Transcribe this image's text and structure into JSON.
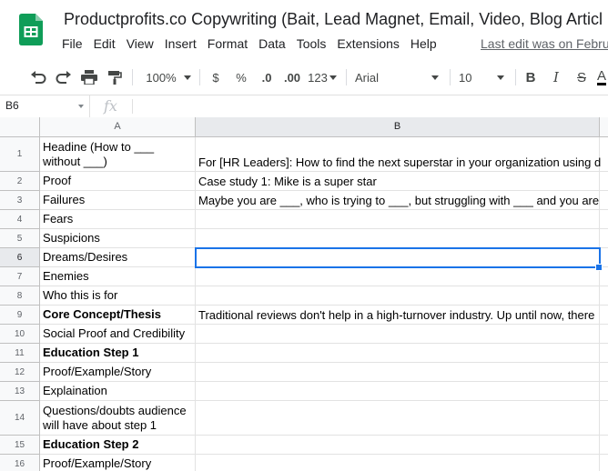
{
  "doc": {
    "title": "Productprofits.co Copywriting (Bait, Lead Magnet, Email, Video, Blog Articl",
    "last_edit": "Last edit was on Febru"
  },
  "menu": [
    "File",
    "Edit",
    "View",
    "Insert",
    "Format",
    "Data",
    "Tools",
    "Extensions",
    "Help"
  ],
  "toolbar": {
    "zoom": "100%",
    "currency": "$",
    "percent": "%",
    "decrease_decimal": ".0",
    "increase_decimal": ".00",
    "more_formats": "123",
    "font": "Arial",
    "font_size": "10",
    "bold": "B",
    "italic": "I",
    "strike": "S",
    "text_color": "A"
  },
  "formula_bar": {
    "cell_ref": "B6",
    "fx": "fx"
  },
  "columns": [
    "A",
    "B"
  ],
  "rows": [
    {
      "num": "1",
      "a": "Headine (How to ___ without ___)",
      "b": "For [HR Leaders]: How to find the next superstar in your organization using d"
    },
    {
      "num": "2",
      "a": "Proof",
      "b": "Case study 1: Mike is a super star"
    },
    {
      "num": "3",
      "a": "Failures",
      "b": "Maybe you are ___, who is trying to ___, but struggling with ___ and you are"
    },
    {
      "num": "4",
      "a": "Fears",
      "b": ""
    },
    {
      "num": "5",
      "a": "Suspicions",
      "b": ""
    },
    {
      "num": "6",
      "a": "Dreams/Desires",
      "b": ""
    },
    {
      "num": "7",
      "a": "Enemies",
      "b": ""
    },
    {
      "num": "8",
      "a": "Who this is for",
      "b": ""
    },
    {
      "num": "9",
      "a": "Core Concept/Thesis",
      "b": "Traditional reviews don't help in a high-turnover industry. Up until now, there"
    },
    {
      "num": "10",
      "a": "Social Proof and Credibility",
      "b": ""
    },
    {
      "num": "11",
      "a": "Education Step 1",
      "b": ""
    },
    {
      "num": "12",
      "a": "Proof/Example/Story",
      "b": ""
    },
    {
      "num": "13",
      "a": "Explaination",
      "b": ""
    },
    {
      "num": "14",
      "a": "Questions/doubts audience will have about step 1",
      "b": ""
    },
    {
      "num": "15",
      "a": "Education Step 2",
      "b": ""
    },
    {
      "num": "16",
      "a": "Proof/Example/Story",
      "b": ""
    }
  ],
  "colors": {
    "sheets_green": "#0f9d58",
    "selection_blue": "#1a73e8"
  }
}
